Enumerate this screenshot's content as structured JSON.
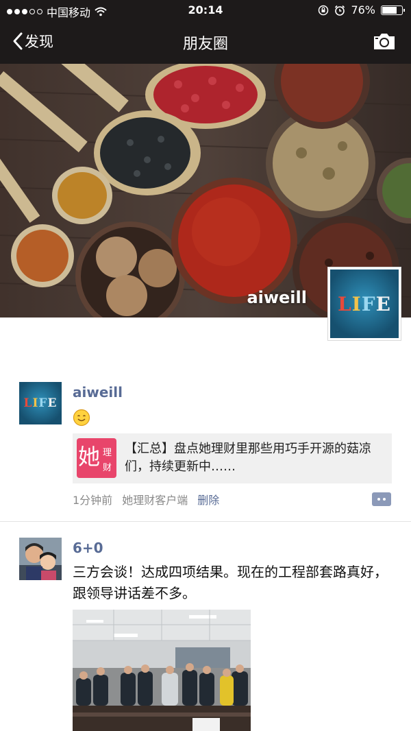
{
  "status_bar": {
    "carrier": "中国移动",
    "time": "20:14",
    "battery": "76%",
    "battery_level": 0.76
  },
  "nav": {
    "back_label": "发现",
    "title": "朋友圈"
  },
  "profile": {
    "name": "aiweill",
    "avatar_text": "LIFE"
  },
  "posts": [
    {
      "user": "aiweill",
      "avatar_text": "LIFE",
      "emoji": "smiling-face-emoji",
      "link": {
        "icon_big": "她",
        "icon_small_1": "理",
        "icon_small_2": "财",
        "text": "【汇总】盘点她理财里那些用巧手开源的菇凉们，持续更新中……"
      },
      "time": "1分钟前",
      "source": "她理财客户端",
      "delete_label": "删除"
    },
    {
      "user": "6+0",
      "text": "三方会谈！达成四项结果。现在的工程部套路真好，跟领导讲话差不多。"
    }
  ],
  "colors": {
    "nav_bg": "#1d1a1a",
    "username": "#586b95",
    "link_icon": "#e8456b"
  }
}
